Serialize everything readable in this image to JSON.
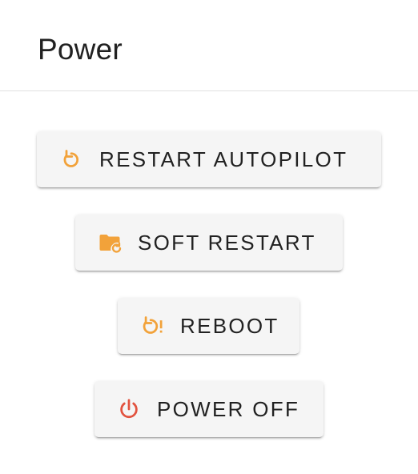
{
  "title": "Power",
  "colors": {
    "accent_orange": "#f2a23a",
    "danger_red": "#e2533f"
  },
  "buttons": [
    {
      "label": "RESTART AUTOPILOT",
      "icon": "restart-icon"
    },
    {
      "label": "SOFT RESTART",
      "icon": "folder-refresh-icon"
    },
    {
      "label": "REBOOT",
      "icon": "restart-alert-icon"
    },
    {
      "label": "POWER OFF",
      "icon": "power-icon"
    }
  ]
}
